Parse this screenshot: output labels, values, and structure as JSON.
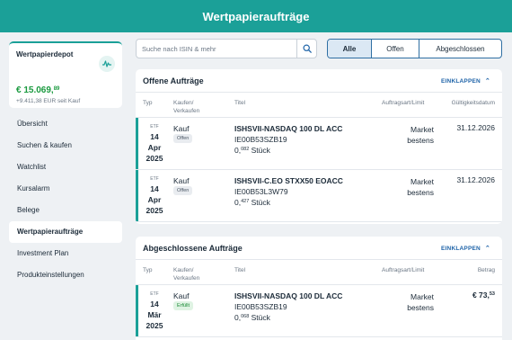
{
  "header": {
    "title": "Wertpapieraufträge"
  },
  "depot": {
    "title": "Wertpapierdepot",
    "value_main": "€ 15.069,",
    "value_cents": "89",
    "change": "+9.411,38 EUR seit Kauf",
    "icon": "chart-activity-icon"
  },
  "nav": {
    "items": [
      {
        "label": "Übersicht",
        "active": false
      },
      {
        "label": "Suchen & kaufen",
        "active": false
      },
      {
        "label": "Watchlist",
        "active": false
      },
      {
        "label": "Kursalarm",
        "active": false
      },
      {
        "label": "Belege",
        "active": false
      },
      {
        "label": "Wertpapieraufträge",
        "active": true
      },
      {
        "label": "Investment Plan",
        "active": false
      },
      {
        "label": "Produkteinstellungen",
        "active": false
      }
    ]
  },
  "search": {
    "placeholder": "Suche nach ISIN & mehr",
    "value": ""
  },
  "filters": {
    "all": "Alle",
    "open": "Offen",
    "done": "Abgeschlossen",
    "selected": "Alle"
  },
  "open_orders": {
    "title": "Offene Aufträge",
    "collapse_label": "EINKLAPPEN",
    "columns": {
      "type": "Typ",
      "side_line1": "Kaufen/",
      "side_line2": "Verkaufen",
      "title": "Titel",
      "order_type": "Auftragsart/Limit",
      "valid_until": "Gültigkeitsdatum"
    },
    "rows": [
      {
        "kind": "ETF",
        "day": "14",
        "month": "Apr",
        "year": "2025",
        "side": "Kauf",
        "status": "Offen",
        "title": "ISHSVII-NASDAQ 100 DL ACC",
        "isin": "IE00B53SZB19",
        "qty_int": "0,",
        "qty_frac": "082",
        "qty_unit": " Stück",
        "order_line1": "Market",
        "order_line2": "bestens",
        "right": "31.12.2026"
      },
      {
        "kind": "ETF",
        "day": "14",
        "month": "Apr",
        "year": "2025",
        "side": "Kauf",
        "status": "Offen",
        "title": "ISHSVII-C.EO STXX50 EOACC",
        "isin": "IE00B53L3W79",
        "qty_int": "0,",
        "qty_frac": "427",
        "qty_unit": " Stück",
        "order_line1": "Market",
        "order_line2": "bestens",
        "right": "31.12.2026"
      }
    ]
  },
  "done_orders": {
    "title": "Abgeschlossene Aufträge",
    "collapse_label": "EINKLAPPEN",
    "columns": {
      "type": "Typ",
      "side_line1": "Kaufen/",
      "side_line2": "Verkaufen",
      "title": "Titel",
      "order_type": "Auftragsart/Limit",
      "amount": "Betrag"
    },
    "rows": [
      {
        "kind": "ETF",
        "day": "14",
        "month": "Mär",
        "year": "2025",
        "side": "Kauf",
        "status": "Erfüllt",
        "title": "ISHSVII-NASDAQ 100 DL ACC",
        "isin": "IE00B53SZB19",
        "qty_int": "0,",
        "qty_frac": "068",
        "qty_unit": " Stück",
        "order_line1": "Market",
        "order_line2": "bestens",
        "amount_main": "€ 73,",
        "amount_cents": "53"
      }
    ]
  },
  "colors": {
    "brand": "#1ba098",
    "link": "#1e63a8",
    "positive": "#1a9a3f"
  }
}
